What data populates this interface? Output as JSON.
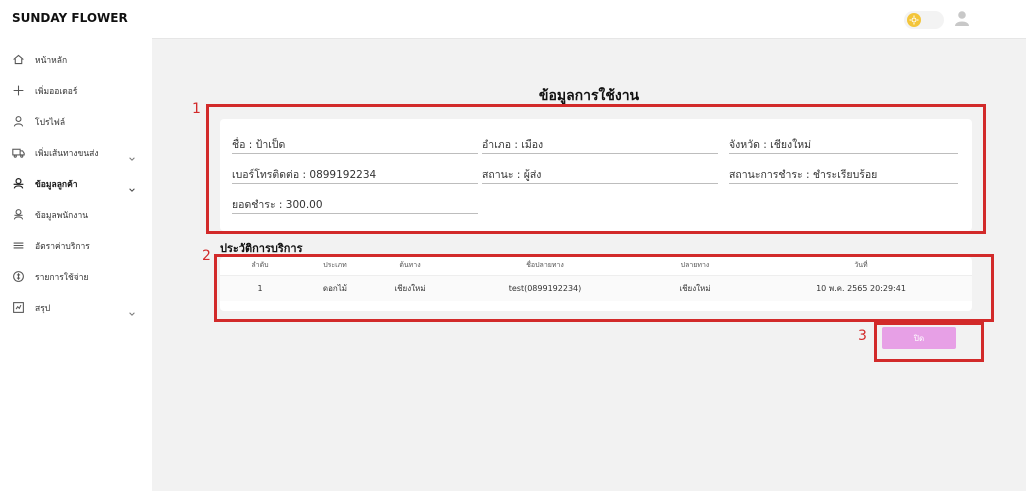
{
  "brand": "SUNDAY FLOWER",
  "sidebar": {
    "items": [
      {
        "label": "หน้าหลัก",
        "icon": "home-icon",
        "has_chevron": false
      },
      {
        "label": "เพิ่มออเดอร์",
        "icon": "plus-icon",
        "has_chevron": false
      },
      {
        "label": "โปรไฟล์",
        "icon": "user-icon",
        "has_chevron": false
      },
      {
        "label": "เพิ่มเส้นทางขนส่ง",
        "icon": "truck-icon",
        "has_chevron": true
      },
      {
        "label": "ข้อมูลลูกค้า",
        "icon": "users-icon",
        "has_chevron": true
      },
      {
        "label": "ข้อมูลพนักงาน",
        "icon": "employee-icon",
        "has_chevron": false
      },
      {
        "label": "อัตราค่าบริการ",
        "icon": "rate-icon",
        "has_chevron": false
      },
      {
        "label": "รายการใช้จ่าย",
        "icon": "coin-icon",
        "has_chevron": false
      },
      {
        "label": "สรุป",
        "icon": "report-icon",
        "has_chevron": true
      }
    ]
  },
  "header": {
    "theme_toggle_icon": "sun-icon",
    "avatar_icon": "avatar-icon"
  },
  "page": {
    "title": "ข้อมูลการใช้งาน"
  },
  "info": {
    "name_label": "ชื่อ : ",
    "name_value": "ป้าเป็ด",
    "district_label": "อำเภอ : ",
    "district_value": "เมือง",
    "province_label": "จังหวัด : ",
    "province_value": "เชียงใหม่",
    "phone_label": "เบอร์โทรติดต่อ : ",
    "phone_value": "0899192234",
    "status_label": "สถานะ : ",
    "status_value": "ผู้ส่ง",
    "payment_status_label": "สถานะการชำระ : ",
    "payment_status_value": "ชำระเรียบร้อย",
    "paid_label": "ยอดชำระ : ",
    "paid_value": "300.00"
  },
  "history": {
    "title": "ประวัติการบริการ",
    "columns": [
      "ลำดับ",
      "ประเภท",
      "ต้นทาง",
      "ชื่อปลายทาง",
      "ปลายทาง",
      "วันที่"
    ],
    "rows": [
      [
        "1",
        "ดอกไม้",
        "เชียงใหม่",
        "test(0899192234)",
        "เชียงใหม่",
        "10 พ.ค. 2565 20:29:41"
      ]
    ]
  },
  "actions": {
    "close_label": "ปิด"
  },
  "annotations": {
    "box1": "1",
    "box2": "2",
    "box3": "3",
    "color": "#d22a2a"
  },
  "colors": {
    "accent": "#e7a0e6",
    "background": "#f2f2f2",
    "sun": "#f3c53a"
  }
}
